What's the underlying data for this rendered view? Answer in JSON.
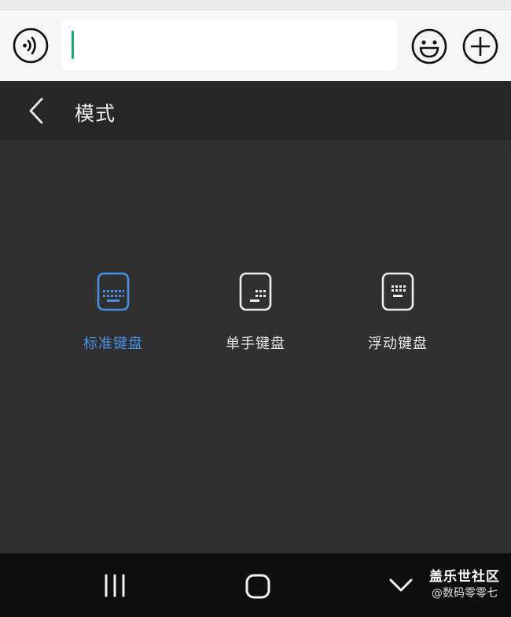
{
  "chat_bar": {
    "voice_icon": "voice-wave-icon",
    "emoji_icon": "smiley-icon",
    "plus_icon": "plus-circle-icon",
    "input_value": ""
  },
  "header": {
    "back_icon": "chevron-left-icon",
    "title": "模式"
  },
  "modes": [
    {
      "label": "标准键盘",
      "icon": "standard-keyboard-icon",
      "selected": true
    },
    {
      "label": "单手键盘",
      "icon": "one-handed-keyboard-icon",
      "selected": false
    },
    {
      "label": "浮动键盘",
      "icon": "floating-keyboard-icon",
      "selected": false
    }
  ],
  "colors": {
    "accent": "#4a8fe3",
    "cursor": "#1aad6f",
    "background": "#303030",
    "header_bg": "#262626",
    "navbar_bg": "#0f0f0f"
  },
  "navbar": {
    "recents_icon": "recents-icon",
    "home_icon": "home-icon",
    "hide_keyboard_icon": "chevron-down-icon"
  },
  "watermark": {
    "title": "盖乐世社区",
    "author": "@数码零零七"
  }
}
